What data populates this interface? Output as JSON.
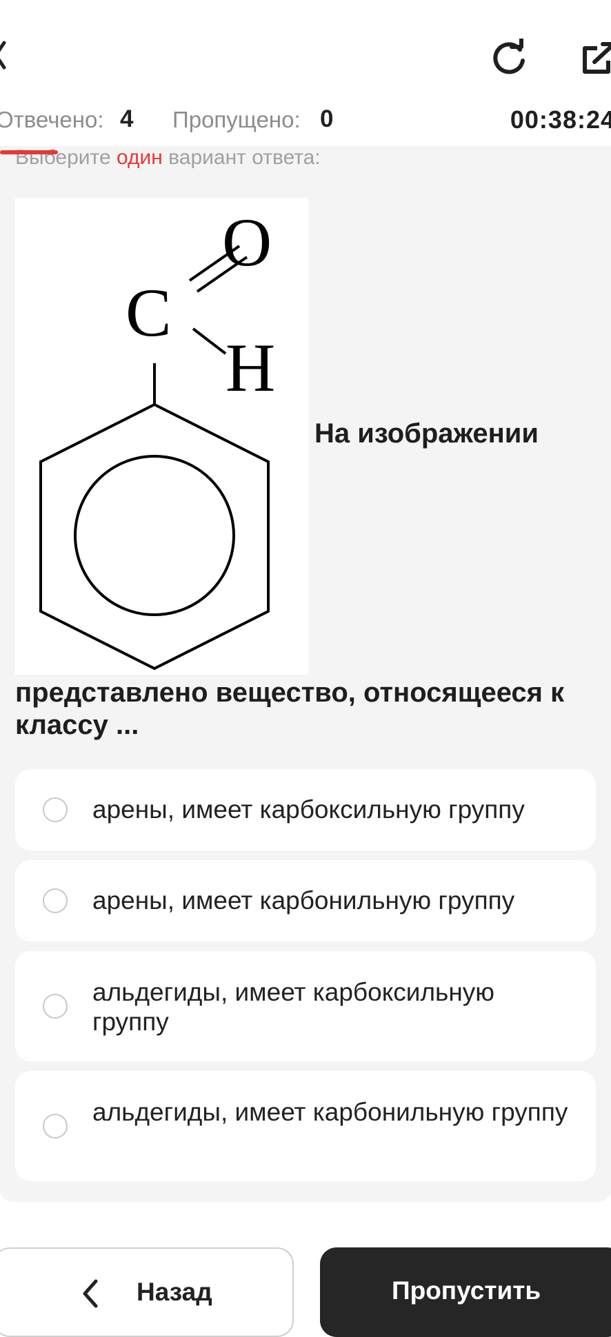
{
  "header": {
    "back_icon": "chevron-left-icon",
    "reload_icon": "reload-icon",
    "share_icon": "external-link-icon"
  },
  "stats": {
    "answered_label": "Отвечено:",
    "answered_value": "4",
    "skipped_label": "Пропущено:",
    "skipped_value": "0",
    "timer": "00:38:24"
  },
  "question": {
    "instruction_before": "Выберите ",
    "instruction_accent": "один",
    "instruction_after": " вариант ответа:",
    "image_labels": {
      "oxygen": "O",
      "carbon": "C",
      "hydrogen": "H"
    },
    "text_inline": "На изображении",
    "text_rest": "представлено вещество, относящееся к классу ..."
  },
  "options": [
    {
      "label": "арены, имеет карбоксильную группу",
      "selected": false
    },
    {
      "label": "арены, имеет карбонильную группу",
      "selected": false
    },
    {
      "label": "альдегиды, имеет карбоксильную группу",
      "selected": false
    },
    {
      "label": "альдегиды, имеет карбонильную группу",
      "selected": false
    }
  ],
  "footer": {
    "back_label": "Назад",
    "skip_label": "Пропустить"
  },
  "colors": {
    "accent": "#e53935",
    "primary_button": "#262626"
  }
}
